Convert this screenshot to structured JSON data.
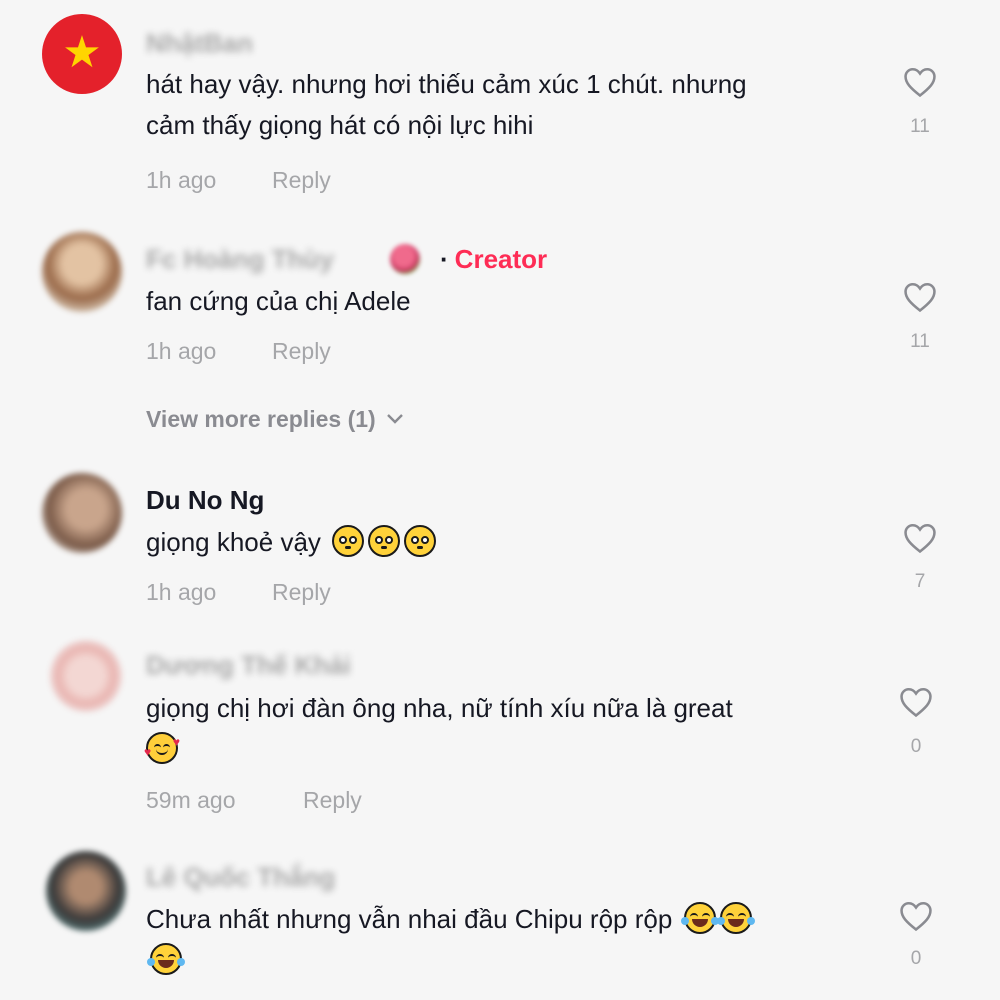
{
  "comments": [
    {
      "name": "NhậtBan",
      "text_lines": [
        "hát hay vậy. nhưng hơi thiếu cảm xúc 1 chút. nhưng",
        "cảm thấy giọng hát có nội lực hihi"
      ],
      "time": "1h ago",
      "reply_label": "Reply",
      "likes": "11"
    },
    {
      "name": "Fc Hoàng Thùy",
      "creator_label": "Creator",
      "text_lines": [
        "fan cứng của chị Adele"
      ],
      "time": "1h ago",
      "reply_label": "Reply",
      "likes": "11",
      "view_more": "View more replies (1)"
    },
    {
      "name": "Du No Ng",
      "text_lines": [
        "giọng khoẻ vậy"
      ],
      "time": "1h ago",
      "reply_label": "Reply",
      "likes": "7"
    },
    {
      "name": "Dương Thế Khải",
      "text_lines": [
        "giọng chị hơi đàn ông nha, nữ tính xíu nữa là great"
      ],
      "time": "59m ago",
      "reply_label": "Reply",
      "likes": "0"
    },
    {
      "name": "Lê Quốc Thắng",
      "text_lines": [
        "Chưa nhất nhưng vẫn nhai đầu Chipu rộp rộp"
      ],
      "time": "",
      "reply_label": "",
      "likes": "0"
    }
  ],
  "icons": {
    "like": "heart-outline-icon",
    "expand": "chevron-down-icon",
    "flag_avatar": "vietnam-flag-icon"
  },
  "colors": {
    "background": "#f6f6f6",
    "creator": "#fe2c55",
    "muted": "#a5a6a9",
    "text": "#161823"
  }
}
